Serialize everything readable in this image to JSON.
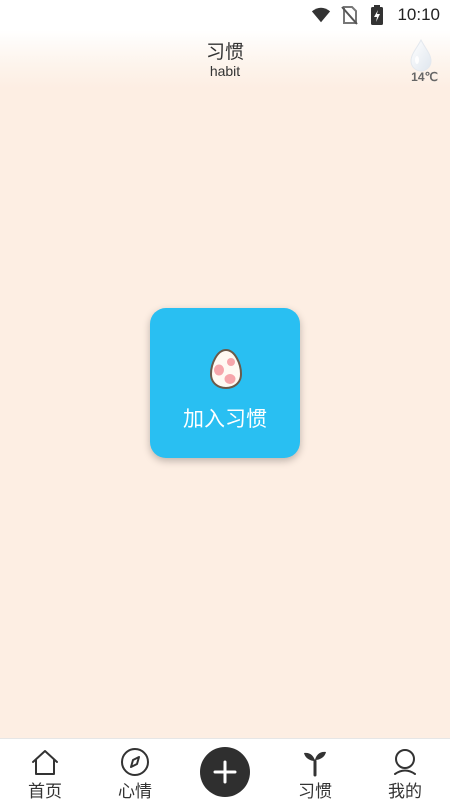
{
  "status_bar": {
    "time": "10:10",
    "icons": [
      "wifi-icon",
      "no-sim-icon",
      "battery-charging-icon"
    ]
  },
  "header": {
    "title": "习惯",
    "subtitle": "habit",
    "weather": {
      "icon": "raindrop-icon",
      "temperature": "14℃"
    }
  },
  "main": {
    "join_button": {
      "icon": "egg-icon",
      "label": "加入习惯"
    }
  },
  "bottom_nav": {
    "items": [
      {
        "label": "首页",
        "icon": "home-icon"
      },
      {
        "label": "心情",
        "icon": "compass-icon"
      },
      {
        "label": "",
        "icon": "plus-icon"
      },
      {
        "label": "习惯",
        "icon": "sprout-icon"
      },
      {
        "label": "我的",
        "icon": "profile-icon"
      }
    ]
  },
  "colors": {
    "background": "#fdeee3",
    "accent": "#29bff2",
    "add_button": "#2f2f2f"
  }
}
